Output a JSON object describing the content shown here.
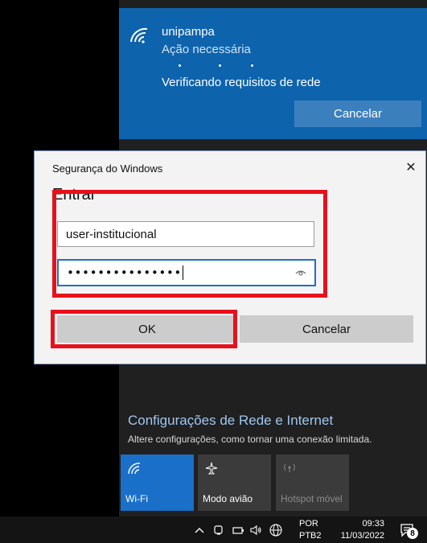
{
  "network_card": {
    "name": "unipampa",
    "status": "Ação necessária",
    "message": "Verificando requisitos de rede",
    "cancel_label": "Cancelar"
  },
  "dialog": {
    "title": "Segurança do Windows",
    "heading": "Entrar",
    "username_value": "user-institucional",
    "password_masked": "•••••••••••••••",
    "ok_label": "OK",
    "cancel_label": "Cancelar",
    "close_glyph": "✕"
  },
  "network_settings": {
    "link": "Configurações de Rede e Internet",
    "subtitle": "Altere configurações, como tornar uma conexão limitada."
  },
  "quick_actions": [
    {
      "label": "Wi-Fi",
      "active": true,
      "icon": "wifi-icon"
    },
    {
      "label": "Modo avião",
      "active": false,
      "icon": "airplane-icon"
    },
    {
      "label": "Hotspot móvel",
      "active": false,
      "disabled": true,
      "icon": "hotspot-icon"
    }
  ],
  "taskbar": {
    "lang_top": "POR",
    "lang_bottom": "PTB2",
    "time": "09:33",
    "date": "11/03/2022",
    "notification_count": "8"
  },
  "colors": {
    "network_card": "#0e63ad",
    "accent": "#1a6fc9",
    "highlight": "#e8101c"
  }
}
